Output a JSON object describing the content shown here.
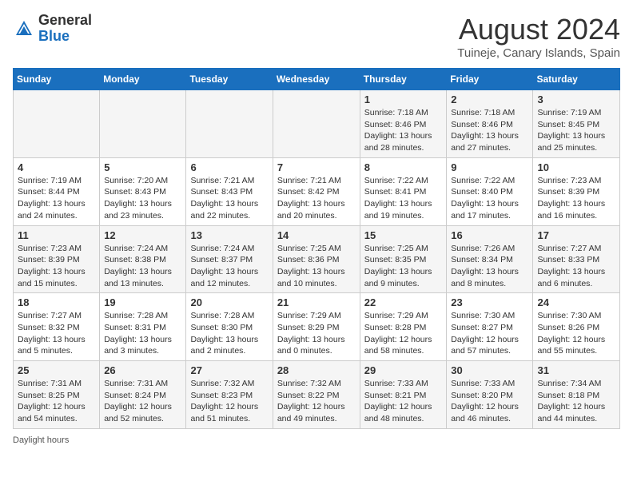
{
  "header": {
    "logo_general": "General",
    "logo_blue": "Blue",
    "month_title": "August 2024",
    "subtitle": "Tuineje, Canary Islands, Spain"
  },
  "days_of_week": [
    "Sunday",
    "Monday",
    "Tuesday",
    "Wednesday",
    "Thursday",
    "Friday",
    "Saturday"
  ],
  "weeks": [
    [
      {
        "day": "",
        "info": ""
      },
      {
        "day": "",
        "info": ""
      },
      {
        "day": "",
        "info": ""
      },
      {
        "day": "",
        "info": ""
      },
      {
        "day": "1",
        "info": "Sunrise: 7:18 AM\nSunset: 8:46 PM\nDaylight: 13 hours\nand 28 minutes."
      },
      {
        "day": "2",
        "info": "Sunrise: 7:18 AM\nSunset: 8:46 PM\nDaylight: 13 hours\nand 27 minutes."
      },
      {
        "day": "3",
        "info": "Sunrise: 7:19 AM\nSunset: 8:45 PM\nDaylight: 13 hours\nand 25 minutes."
      }
    ],
    [
      {
        "day": "4",
        "info": "Sunrise: 7:19 AM\nSunset: 8:44 PM\nDaylight: 13 hours\nand 24 minutes."
      },
      {
        "day": "5",
        "info": "Sunrise: 7:20 AM\nSunset: 8:43 PM\nDaylight: 13 hours\nand 23 minutes."
      },
      {
        "day": "6",
        "info": "Sunrise: 7:21 AM\nSunset: 8:43 PM\nDaylight: 13 hours\nand 22 minutes."
      },
      {
        "day": "7",
        "info": "Sunrise: 7:21 AM\nSunset: 8:42 PM\nDaylight: 13 hours\nand 20 minutes."
      },
      {
        "day": "8",
        "info": "Sunrise: 7:22 AM\nSunset: 8:41 PM\nDaylight: 13 hours\nand 19 minutes."
      },
      {
        "day": "9",
        "info": "Sunrise: 7:22 AM\nSunset: 8:40 PM\nDaylight: 13 hours\nand 17 minutes."
      },
      {
        "day": "10",
        "info": "Sunrise: 7:23 AM\nSunset: 8:39 PM\nDaylight: 13 hours\nand 16 minutes."
      }
    ],
    [
      {
        "day": "11",
        "info": "Sunrise: 7:23 AM\nSunset: 8:39 PM\nDaylight: 13 hours\nand 15 minutes."
      },
      {
        "day": "12",
        "info": "Sunrise: 7:24 AM\nSunset: 8:38 PM\nDaylight: 13 hours\nand 13 minutes."
      },
      {
        "day": "13",
        "info": "Sunrise: 7:24 AM\nSunset: 8:37 PM\nDaylight: 13 hours\nand 12 minutes."
      },
      {
        "day": "14",
        "info": "Sunrise: 7:25 AM\nSunset: 8:36 PM\nDaylight: 13 hours\nand 10 minutes."
      },
      {
        "day": "15",
        "info": "Sunrise: 7:25 AM\nSunset: 8:35 PM\nDaylight: 13 hours\nand 9 minutes."
      },
      {
        "day": "16",
        "info": "Sunrise: 7:26 AM\nSunset: 8:34 PM\nDaylight: 13 hours\nand 8 minutes."
      },
      {
        "day": "17",
        "info": "Sunrise: 7:27 AM\nSunset: 8:33 PM\nDaylight: 13 hours\nand 6 minutes."
      }
    ],
    [
      {
        "day": "18",
        "info": "Sunrise: 7:27 AM\nSunset: 8:32 PM\nDaylight: 13 hours\nand 5 minutes."
      },
      {
        "day": "19",
        "info": "Sunrise: 7:28 AM\nSunset: 8:31 PM\nDaylight: 13 hours\nand 3 minutes."
      },
      {
        "day": "20",
        "info": "Sunrise: 7:28 AM\nSunset: 8:30 PM\nDaylight: 13 hours\nand 2 minutes."
      },
      {
        "day": "21",
        "info": "Sunrise: 7:29 AM\nSunset: 8:29 PM\nDaylight: 13 hours\nand 0 minutes."
      },
      {
        "day": "22",
        "info": "Sunrise: 7:29 AM\nSunset: 8:28 PM\nDaylight: 12 hours\nand 58 minutes."
      },
      {
        "day": "23",
        "info": "Sunrise: 7:30 AM\nSunset: 8:27 PM\nDaylight: 12 hours\nand 57 minutes."
      },
      {
        "day": "24",
        "info": "Sunrise: 7:30 AM\nSunset: 8:26 PM\nDaylight: 12 hours\nand 55 minutes."
      }
    ],
    [
      {
        "day": "25",
        "info": "Sunrise: 7:31 AM\nSunset: 8:25 PM\nDaylight: 12 hours\nand 54 minutes."
      },
      {
        "day": "26",
        "info": "Sunrise: 7:31 AM\nSunset: 8:24 PM\nDaylight: 12 hours\nand 52 minutes."
      },
      {
        "day": "27",
        "info": "Sunrise: 7:32 AM\nSunset: 8:23 PM\nDaylight: 12 hours\nand 51 minutes."
      },
      {
        "day": "28",
        "info": "Sunrise: 7:32 AM\nSunset: 8:22 PM\nDaylight: 12 hours\nand 49 minutes."
      },
      {
        "day": "29",
        "info": "Sunrise: 7:33 AM\nSunset: 8:21 PM\nDaylight: 12 hours\nand 48 minutes."
      },
      {
        "day": "30",
        "info": "Sunrise: 7:33 AM\nSunset: 8:20 PM\nDaylight: 12 hours\nand 46 minutes."
      },
      {
        "day": "31",
        "info": "Sunrise: 7:34 AM\nSunset: 8:18 PM\nDaylight: 12 hours\nand 44 minutes."
      }
    ]
  ],
  "legend": {
    "daylight_label": "Daylight hours"
  }
}
